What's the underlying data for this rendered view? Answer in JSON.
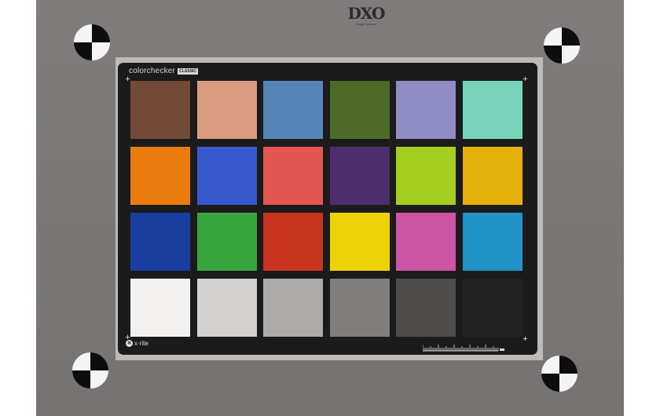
{
  "logo": {
    "text": "DXO",
    "subtext": "Image Science"
  },
  "chart": {
    "brand": "colorchecker",
    "badge": "CLASSIC",
    "maker": "x·rite",
    "maker_mark": "✕",
    "patches": [
      {
        "row": 0,
        "col": 0,
        "color": "#734a37"
      },
      {
        "row": 0,
        "col": 1,
        "color": "#d99c80"
      },
      {
        "row": 0,
        "col": 2,
        "color": "#5585b8"
      },
      {
        "row": 0,
        "col": 3,
        "color": "#4b6b26"
      },
      {
        "row": 0,
        "col": 4,
        "color": "#8f8cc6"
      },
      {
        "row": 0,
        "col": 5,
        "color": "#78d3bb"
      },
      {
        "row": 1,
        "col": 0,
        "color": "#e97c0c"
      },
      {
        "row": 1,
        "col": 1,
        "color": "#375acf"
      },
      {
        "row": 1,
        "col": 2,
        "color": "#e35550"
      },
      {
        "row": 1,
        "col": 3,
        "color": "#4f2e6d"
      },
      {
        "row": 1,
        "col": 4,
        "color": "#a5cf20"
      },
      {
        "row": 1,
        "col": 5,
        "color": "#e6b00c"
      },
      {
        "row": 2,
        "col": 0,
        "color": "#1a3ea0"
      },
      {
        "row": 2,
        "col": 1,
        "color": "#38a53f"
      },
      {
        "row": 2,
        "col": 2,
        "color": "#c7341f"
      },
      {
        "row": 2,
        "col": 3,
        "color": "#eed208"
      },
      {
        "row": 2,
        "col": 4,
        "color": "#cc56a3"
      },
      {
        "row": 2,
        "col": 5,
        "color": "#2193c6"
      },
      {
        "row": 3,
        "col": 0,
        "color": "#f2f1ef"
      },
      {
        "row": 3,
        "col": 1,
        "color": "#d2d1cf"
      },
      {
        "row": 3,
        "col": 2,
        "color": "#acaba9"
      },
      {
        "row": 3,
        "col": 3,
        "color": "#807e7c"
      },
      {
        "row": 3,
        "col": 4,
        "color": "#4e4d4c"
      },
      {
        "row": 3,
        "col": 5,
        "color": "#232324"
      }
    ]
  },
  "background_color": "#7d7a79",
  "card_color": "#1b1b1c"
}
